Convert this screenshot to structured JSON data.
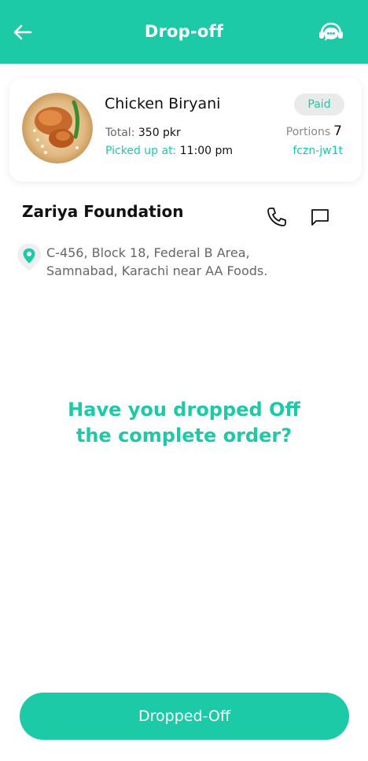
{
  "header": {
    "title": "Drop-off",
    "back_icon": "arrow-left-icon",
    "support_icon": "chat-support-icon",
    "background": "#1dcaa8"
  },
  "order": {
    "food_name": "Chicken Biryani",
    "total_label": "Total:",
    "total_value": "350 pkr",
    "picked_label": "Picked up at:",
    "picked_value": "11:00 pm",
    "status_badge": "Paid",
    "portions_label": "Portions",
    "portions_value": "7",
    "code": "fczn-jw1t"
  },
  "recipient": {
    "name": "Zariya Foundation",
    "address_line1": "C-456, Block 18, Federal B Area,",
    "address_line2": "Samnabad, Karachi near AA Foods.",
    "phone_icon": "phone-icon",
    "message_icon": "message-icon",
    "location_icon": "location-pin-icon"
  },
  "prompt": {
    "line1": "Have you dropped Off",
    "line2": "the complete order?"
  },
  "actions": {
    "primary_label": "Dropped-Off"
  },
  "colors": {
    "accent": "#1dcaa8",
    "badge_bg": "#eaeaea",
    "muted_text": "#666666"
  }
}
